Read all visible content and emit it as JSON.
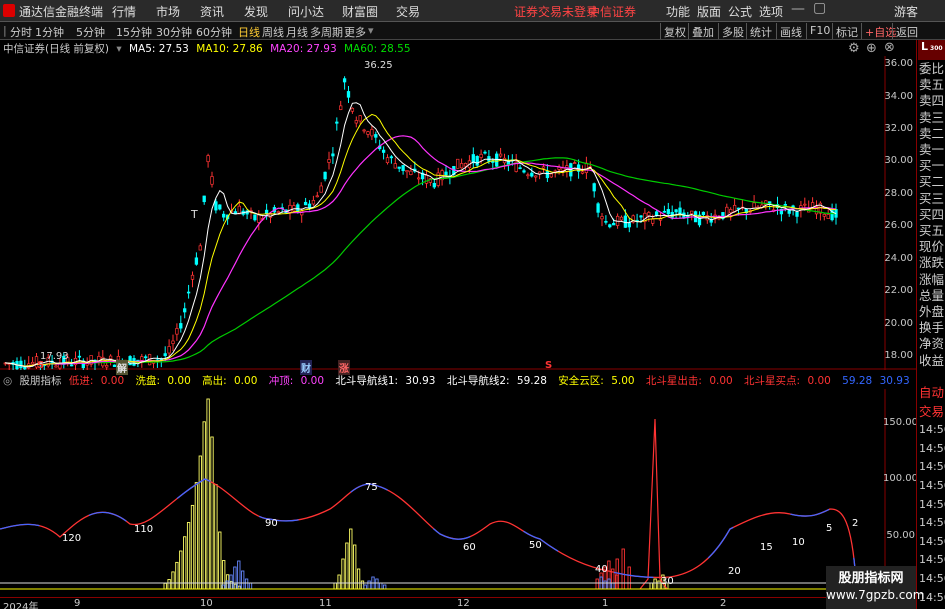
{
  "menubar": {
    "logo_text": "通达信金融终端",
    "items": [
      "行情",
      "市场",
      "资讯",
      "发现",
      "问小达",
      "财富圈",
      "交易"
    ],
    "status": "证券交易未登录",
    "broker": "中信证券",
    "right_items": [
      "功能",
      "版面",
      "公式",
      "选项"
    ],
    "guest": "游客"
  },
  "toolbar": {
    "periods": [
      "分时",
      "1分钟",
      "5分钟",
      "15分钟",
      "30分钟",
      "60分钟",
      "日线",
      "周线",
      "月线",
      "多周期",
      "更多"
    ],
    "active_period": "日线",
    "right_buttons": [
      "复权",
      "叠加",
      "多股",
      "统计",
      "画线",
      "F10",
      "标记",
      "+自选",
      "返回"
    ]
  },
  "main_chart": {
    "title": "中信证券(日线 前复权)",
    "ma": [
      {
        "label": "MA5: 27.53",
        "color": "#ffffff"
      },
      {
        "label": "MA10: 27.86",
        "color": "#ffff00"
      },
      {
        "label": "MA20: 27.93",
        "color": "#ff44ff"
      },
      {
        "label": "MA60: 28.55",
        "color": "#00dd00"
      }
    ],
    "high_label": "36.25",
    "low_label": "17.93",
    "y_ticks": [
      "36.00",
      "34.00",
      "32.00",
      "30.00",
      "28.00",
      "26.00",
      "24.00",
      "22.00",
      "20.00",
      "18.00"
    ],
    "event_markers": [
      "解",
      "财",
      "涨"
    ]
  },
  "indicator": {
    "name": "股朋指标",
    "items": [
      {
        "label": "低进:",
        "value": "0.00",
        "color": "#ff3333"
      },
      {
        "label": "洗盘:",
        "value": "0.00",
        "color": "#ffff00"
      },
      {
        "label": "高出:",
        "value": "0.00",
        "color": "#ffff00"
      },
      {
        "label": "冲顶:",
        "value": "0.00",
        "color": "#ff44ff"
      },
      {
        "label": "北斗导航线1:",
        "value": "30.93",
        "color": "#ffffff"
      },
      {
        "label": "北斗导航线2:",
        "value": "59.28",
        "color": "#ffffff"
      },
      {
        "label": "安全云区:",
        "value": "5.00",
        "color": "#ffff00"
      },
      {
        "label": "北斗星出击:",
        "value": "0.00",
        "color": "#ff3333"
      },
      {
        "label": "北斗星买点:",
        "value": "0.00",
        "color": "#ff3333"
      },
      {
        "label": "",
        "value": "59.28",
        "color": "#3366ff"
      },
      {
        "label": "",
        "value": "30.93",
        "color": "#3366ff"
      }
    ],
    "y_ticks": [
      "150.00",
      "100.00",
      "50.00"
    ],
    "wave_labels": [
      "120",
      "110",
      "90",
      "75",
      "60",
      "50",
      "40",
      "30",
      "20",
      "15",
      "10",
      "5",
      "2",
      "1"
    ]
  },
  "x_axis": {
    "labels": [
      "2024年",
      "9",
      "10",
      "11",
      "12",
      "1",
      "2"
    ]
  },
  "right_panel": {
    "top": "L",
    "top_sub": "300",
    "items": [
      "委比",
      "卖五",
      "卖四",
      "卖三",
      "卖二",
      "卖一",
      "买一",
      "买二",
      "买三",
      "买四",
      "买五",
      "现价",
      "涨跌",
      "涨幅",
      "总量",
      "外盘",
      "换手",
      "净资",
      "收益",
      "自动",
      "交易",
      "14:56",
      "14:56",
      "14:56",
      "14:56",
      "14:56",
      "14:56",
      "14:56",
      "14:56",
      "14:56",
      "14:56"
    ]
  },
  "watermark": {
    "line1": "股朋指标网",
    "line2": "www.7gpzb.com"
  },
  "chart_data": {
    "type": "candlestick",
    "title": "中信证券(日线 前复权)",
    "ylim": [
      17.5,
      37
    ],
    "high": 36.25,
    "low": 17.93,
    "ma_last": {
      "MA5": 27.53,
      "MA10": 27.86,
      "MA20": 27.93,
      "MA60": 28.55
    },
    "x_ticks": [
      "2024年",
      "9",
      "10",
      "11",
      "12",
      "1",
      "2"
    ]
  }
}
